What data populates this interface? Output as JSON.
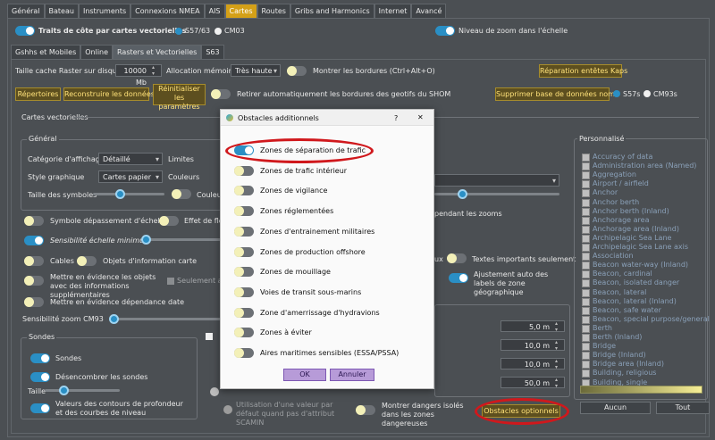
{
  "main_tabs": [
    "Général",
    "Bateau",
    "Instruments",
    "Connexions NMEA",
    "AIS",
    "Cartes",
    "Routes",
    "Gribs and Harmonics",
    "Internet",
    "Avancé"
  ],
  "sub_tabs": [
    "Gshhs et Mobiles",
    "Online",
    "Rasters et Vectorielles",
    "S63"
  ],
  "top": {
    "traits_label": "Traits de côte par cartes vectorielles",
    "s57": "S57/63",
    "cm03": "CM03",
    "zoom_label": "Niveau de zoom dans l'échelle"
  },
  "raster": {
    "cache_label": "Taille cache Raster sur disque",
    "cache_value": "10000 Mb",
    "alloc_label": "Allocation mémoire",
    "alloc_value": "Très haute",
    "borders_label": "Montrer les bordures (Ctrl+Alt+O)",
    "repair_btn": "Réparation entêtes Kaps",
    "repertoires_btn": "Répertoires",
    "rebuild_btn": "Reconstruire les données",
    "reinit_btn": "Réinitialiser les paramètres",
    "retirer_label": "Retirer automatiquement les bordures des geotifs du SHOM",
    "suppr_btn": "Supprimer base de données noms",
    "s57s": "S57s",
    "cm93s": "CM93s"
  },
  "vector": {
    "section": "Cartes vectorielles",
    "general": "Général",
    "cat_label": "Catégorie d'affichage",
    "cat_value": "Détaillé",
    "limites": "Limites",
    "style_label": "Style graphique",
    "style_value": "Cartes papier",
    "couleurs": "Couleurs",
    "symbol_size": "Taille des symboles",
    "couleur_cut": "Couleur",
    "sym_depass": "Symbole dépassement d'échelle",
    "effet": "Effet de flo",
    "sensib_min": "Sensibilité échelle minimum",
    "cables": "Cables",
    "objets_info": "Objets d'information carte",
    "mettre_obj": "Mettre en évidence les objets avec des informations supplémentaires",
    "seulement": "Seulement ava",
    "mettre_dep": "Mettre en évidence dépendance date",
    "sensib_cm93": "Sensibilité zoom CM93",
    "pendant_zooms": "pendant les zooms",
    "ux": "ux",
    "textes_imp": "Textes importants seulement",
    "ajust": "Ajustement auto des labels de zone géographique",
    "sondes_section": "Sondes",
    "sondes": "Sondes",
    "desencombrer": "Désencombrer les sondes",
    "taille": "Taille",
    "valeurs_contours": "Valeurs des contours de profondeur et des courbes de niveau",
    "utilisation": "Utilisation d'une valeur par défaut quand pas d'attribut SCAMIN",
    "montrer_dangers": "Montrer dangers isolés dans les zones dangereuses",
    "obstacles_btn": "Obstacles optionnels",
    "depths": [
      "5,0 m",
      "10,0 m",
      "10,0 m",
      "50,0 m"
    ]
  },
  "personnalise": {
    "title": "Personnalisé",
    "items": [
      "Accuracy of data",
      "Administration area (Named)",
      "Aggregation",
      "Airport / airfield",
      "Anchor",
      "Anchor berth",
      "Anchor berth (Inland)",
      "Anchorage area",
      "Anchorage area (Inland)",
      "Archipelagic Sea Lane",
      "Archipelagic Sea Lane axis",
      "Association",
      "Beacon water-way (Inland)",
      "Beacon, cardinal",
      "Beacon, isolated danger",
      "Beacon, lateral",
      "Beacon, lateral (Inland)",
      "Beacon, safe water",
      "Beacon, special purpose/general",
      "Berth",
      "Berth (Inland)",
      "Bridge",
      "Bridge (Inland)",
      "Bridge area (Inland)",
      "Building, religious",
      "Building, single"
    ],
    "aucun": "Aucun",
    "tout": "Tout"
  },
  "dialog": {
    "title": "Obstacles additionnels",
    "help": "?",
    "close": "✕",
    "items": [
      {
        "label": "Zones de séparation de trafic",
        "on": true
      },
      {
        "label": "Zones de trafic intérieur",
        "on": false
      },
      {
        "label": "Zones de vigilance",
        "on": false
      },
      {
        "label": "Zones réglementées",
        "on": false
      },
      {
        "label": "Zones d'entrainement militaires",
        "on": false
      },
      {
        "label": "Zones de production offshore",
        "on": false
      },
      {
        "label": "Zones de mouillage",
        "on": false
      },
      {
        "label": "Voies de transit sous-marins",
        "on": false
      },
      {
        "label": "Zone d'amerrissage d'hydravions",
        "on": false
      },
      {
        "label": "Zones à éviter",
        "on": false
      },
      {
        "label": "Aires maritimes sensibles (ESSA/PSSA)",
        "on": false
      }
    ],
    "ok": "OK",
    "annuler": "Annuler"
  },
  "colors": {
    "accent": "#2a8fc5",
    "tab_active": "#d4a017",
    "highlight": "#d0181c"
  }
}
